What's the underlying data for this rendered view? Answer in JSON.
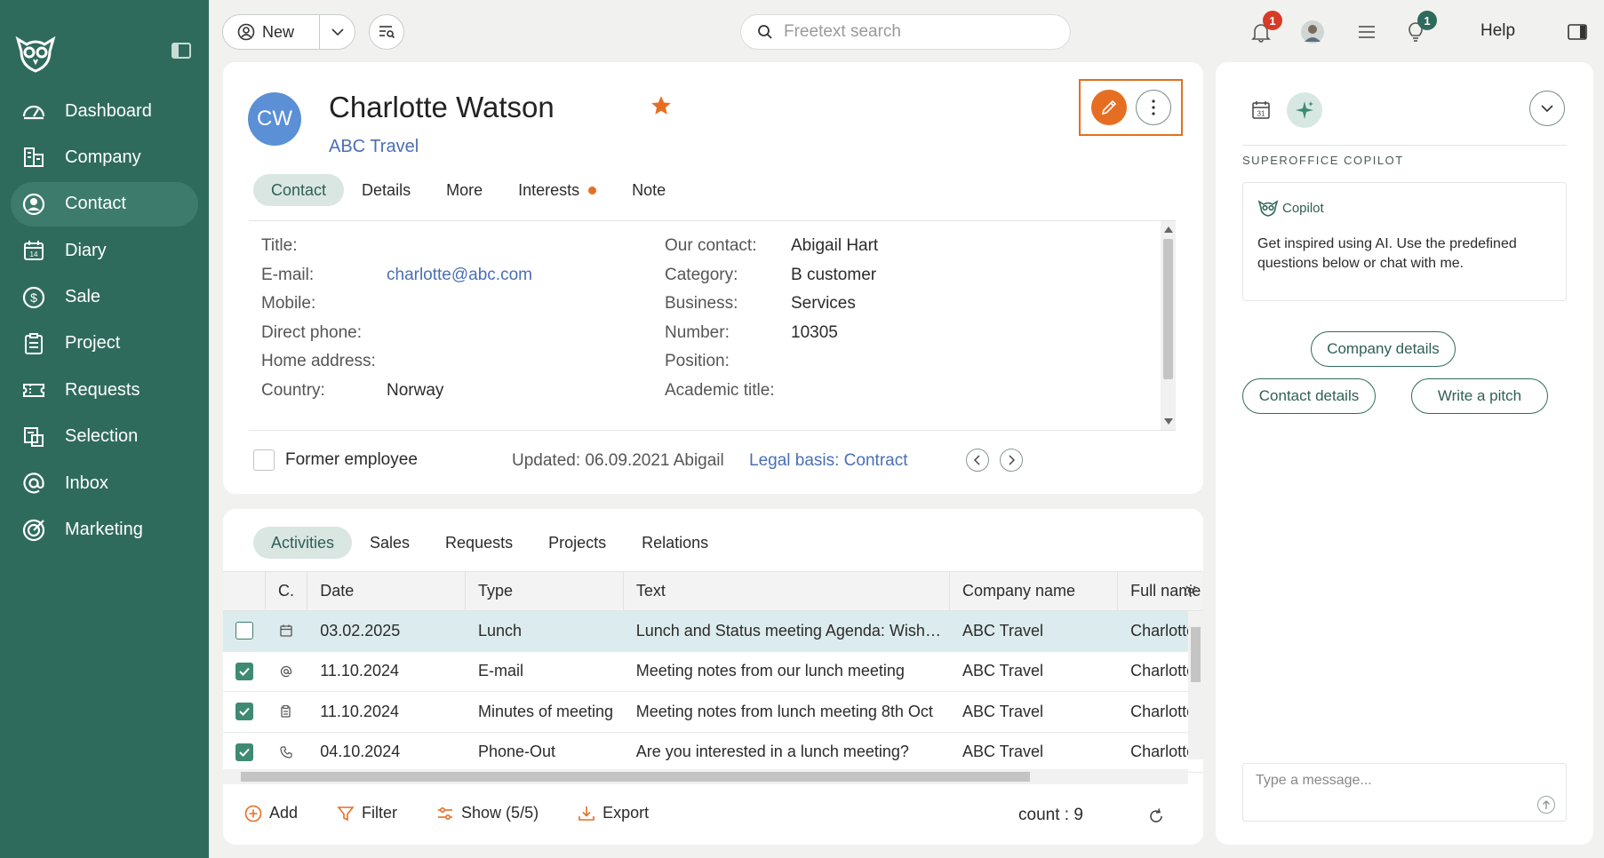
{
  "sidebar": {
    "logo_icon": "owl-logo-icon",
    "collapse_icon": "panel-toggle-icon",
    "items": [
      {
        "label": "Dashboard",
        "icon": "dashboard-icon",
        "active": false
      },
      {
        "label": "Company",
        "icon": "company-icon",
        "active": false
      },
      {
        "label": "Contact",
        "icon": "contact-icon",
        "active": true
      },
      {
        "label": "Diary",
        "icon": "calendar-icon",
        "active": false
      },
      {
        "label": "Sale",
        "icon": "sale-icon",
        "active": false
      },
      {
        "label": "Project",
        "icon": "project-icon",
        "active": false
      },
      {
        "label": "Requests",
        "icon": "ticket-icon",
        "active": false
      },
      {
        "label": "Selection",
        "icon": "selection-icon",
        "active": false
      },
      {
        "label": "Inbox",
        "icon": "at-icon",
        "active": false
      },
      {
        "label": "Marketing",
        "icon": "target-icon",
        "active": false
      }
    ]
  },
  "topbar": {
    "new_label": "New",
    "search_placeholder": "Freetext search",
    "notifications_badge": "1",
    "tips_badge": "1",
    "help_label": "Help"
  },
  "contact": {
    "initials": "CW",
    "name": "Charlotte Watson",
    "company": "ABC Travel",
    "favorite": true,
    "tabs": [
      {
        "label": "Contact",
        "active": true
      },
      {
        "label": "Details",
        "active": false
      },
      {
        "label": "More",
        "active": false
      },
      {
        "label": "Interests",
        "active": false,
        "dot": true
      },
      {
        "label": "Note",
        "active": false
      }
    ],
    "left_fields": [
      {
        "label": "Title:",
        "value": ""
      },
      {
        "label": "E-mail:",
        "value": "charlotte@abc.com"
      },
      {
        "label": "Mobile:",
        "value": ""
      },
      {
        "label": "Direct phone:",
        "value": ""
      },
      {
        "label": "Home address:",
        "value": ""
      },
      {
        "label": "Country:",
        "value": "Norway"
      }
    ],
    "right_fields": [
      {
        "label": "Our contact:",
        "value": "Abigail Hart"
      },
      {
        "label": "Category:",
        "value": "B customer"
      },
      {
        "label": "Business:",
        "value": "Services"
      },
      {
        "label": "Number:",
        "value": "10305"
      },
      {
        "label": "Position:",
        "value": ""
      },
      {
        "label": "Academic title:",
        "value": ""
      }
    ],
    "former_employee_label": "Former employee",
    "former_employee_checked": false,
    "updated": "Updated: 06.09.2021 Abigail",
    "legal_basis": "Legal basis: Contract"
  },
  "activities": {
    "tabs": [
      {
        "label": "Activities",
        "active": true
      },
      {
        "label": "Sales",
        "active": false
      },
      {
        "label": "Requests",
        "active": false
      },
      {
        "label": "Projects",
        "active": false
      },
      {
        "label": "Relations",
        "active": false
      }
    ],
    "columns": [
      "C.",
      "Date",
      "Type",
      "Text",
      "Company name",
      "Full name"
    ],
    "rows": [
      {
        "checked": false,
        "icon": "calendar-icon",
        "date": "03.02.2025",
        "type": "Lunch",
        "text": "Lunch and Status meeting Agenda: Wishes a...",
        "company": "ABC Travel",
        "full_name": "Charlotte Watson",
        "highlight": true
      },
      {
        "checked": true,
        "icon": "at-icon",
        "date": "11.10.2024",
        "type": "E-mail",
        "text": "Meeting notes from our lunch meeting",
        "company": "ABC Travel",
        "full_name": "Charlotte Watson",
        "highlight": false
      },
      {
        "checked": true,
        "icon": "document-icon",
        "date": "11.10.2024",
        "type": "Minutes of meeting",
        "text": "Meeting notes from lunch meeting 8th Oct",
        "company": "ABC Travel",
        "full_name": "Charlotte Watson",
        "highlight": false
      },
      {
        "checked": true,
        "icon": "phone-icon",
        "date": "04.10.2024",
        "type": "Phone-Out",
        "text": "Are you interested in a lunch meeting?",
        "company": "ABC Travel",
        "full_name": "Charlotte Watson",
        "highlight": false
      }
    ],
    "toolbar": {
      "add": "Add",
      "filter": "Filter",
      "show": "Show (5/5)",
      "export": "Export",
      "count": "count : 9"
    }
  },
  "copilot": {
    "heading": "SUPEROFFICE COPILOT",
    "brand": "Copilot",
    "message": "Get inspired using AI. Use the predefined questions below or chat with me.",
    "buttons": [
      "Company details",
      "Contact details",
      "Write a pitch"
    ],
    "input_placeholder": "Type a message..."
  },
  "colors": {
    "sidebar": "#2f6b5c",
    "accent_orange": "#e66e22",
    "link_blue": "#4a6fb5",
    "avatar_blue": "#5b8fd6"
  }
}
